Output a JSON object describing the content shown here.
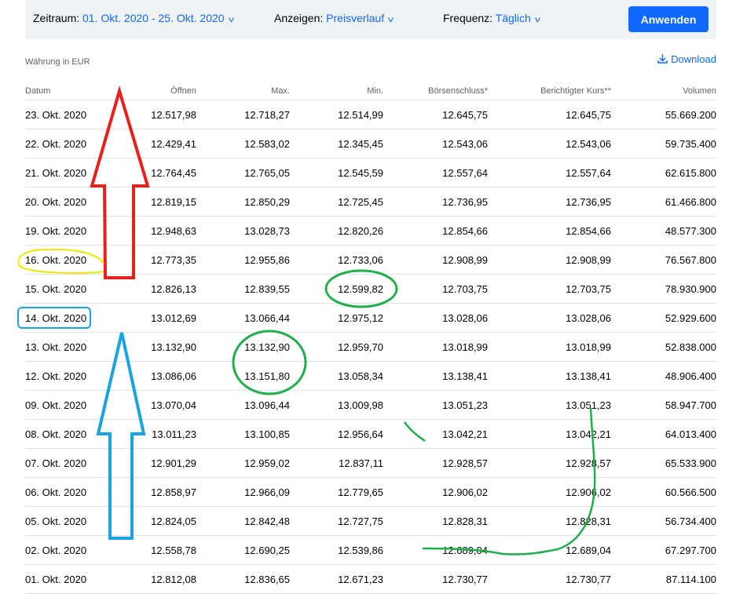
{
  "filter": {
    "period_label": "Zeitraum:",
    "period_value": "01. Okt. 2020 - 25. Okt. 2020",
    "show_label": "Anzeigen:",
    "show_value": "Preisverlauf",
    "freq_label": "Frequenz:",
    "freq_value": "Täglich",
    "apply": "Anwenden"
  },
  "currency": "Währung in EUR",
  "download": "Download",
  "table": {
    "headers": [
      "Datum",
      "Öffnen",
      "Max.",
      "Min.",
      "Börsenschluss*",
      "Berichtigter Kurs**",
      "Volumen"
    ],
    "rows": [
      [
        "23. Okt. 2020",
        "12.517,98",
        "12.718,27",
        "12.514,99",
        "12.645,75",
        "12.645,75",
        "55.669.200"
      ],
      [
        "22. Okt. 2020",
        "12.429,41",
        "12.583,02",
        "12.345,45",
        "12.543,06",
        "12.543,06",
        "59.735.400"
      ],
      [
        "21. Okt. 2020",
        "12.764,45",
        "12.765,05",
        "12.545,59",
        "12.557,64",
        "12.557,64",
        "62.615.800"
      ],
      [
        "20. Okt. 2020",
        "12.819,15",
        "12.850,29",
        "12.725,45",
        "12.736,95",
        "12.736,95",
        "61.466.800"
      ],
      [
        "19. Okt. 2020",
        "12.948,63",
        "13.028,73",
        "12.820,26",
        "12.854,66",
        "12.854,66",
        "48.577.300"
      ],
      [
        "16. Okt. 2020",
        "12.773,35",
        "12.955,86",
        "12.733,06",
        "12.908,99",
        "12.908,99",
        "76.567.800"
      ],
      [
        "15. Okt. 2020",
        "12.826,13",
        "12.839,55",
        "12.599,82",
        "12.703,75",
        "12.703,75",
        "78.930.900"
      ],
      [
        "14. Okt. 2020",
        "13.012,69",
        "13.066,44",
        "12.975,12",
        "13.028,06",
        "13.028,06",
        "52.929.600"
      ],
      [
        "13. Okt. 2020",
        "13.132,90",
        "13.132,90",
        "12.959,70",
        "13.018,99",
        "13.018,99",
        "52.838.000"
      ],
      [
        "12. Okt. 2020",
        "13.086,06",
        "13.151,80",
        "13.058,34",
        "13.138,41",
        "13.138,41",
        "48.906.400"
      ],
      [
        "09. Okt. 2020",
        "13.070,04",
        "13.096,44",
        "13.009,98",
        "13.051,23",
        "13.051,23",
        "58.947.700"
      ],
      [
        "08. Okt. 2020",
        "13.011,23",
        "13.100,85",
        "12.956,64",
        "13.042,21",
        "13.042,21",
        "64.013.400"
      ],
      [
        "07. Okt. 2020",
        "12.901,29",
        "12.959,02",
        "12.837,11",
        "12.928,57",
        "12.928,57",
        "65.533.900"
      ],
      [
        "06. Okt. 2020",
        "12.858,97",
        "12.966,09",
        "12.779,65",
        "12.906,02",
        "12.906,02",
        "60.566.500"
      ],
      [
        "05. Okt. 2020",
        "12.824,05",
        "12.842,48",
        "12.727,75",
        "12.828,31",
        "12.828,31",
        "56.734.400"
      ],
      [
        "02. Okt. 2020",
        "12.558,78",
        "12.690,25",
        "12.539,86",
        "12.689,04",
        "12.689,04",
        "67.297.700"
      ],
      [
        "01. Okt. 2020",
        "12.812,08",
        "12.836,65",
        "12.671,23",
        "12.730,77",
        "12.730,77",
        "87.114.100"
      ]
    ]
  },
  "colors": {
    "accent": "#0f69ff",
    "red": "#e8201c",
    "blue": "#1aa3e0",
    "green": "#1fae4a",
    "yellow": "#f0e600"
  }
}
